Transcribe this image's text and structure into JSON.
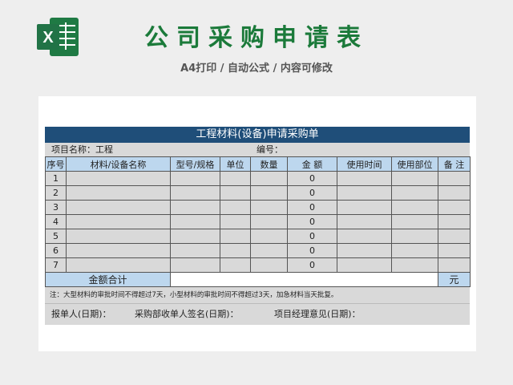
{
  "header": {
    "title": "公司采购申请表",
    "subtitle": "A4打印 / 自动公式 / 内容可修改",
    "logo_icon": "excel-logo-icon",
    "logo_letter": "X",
    "accent_color": "#1b7a3a"
  },
  "form": {
    "title": "工程材料(设备)申请采购单",
    "project_label": "项目名称：工程",
    "number_label": "编号："
  },
  "table": {
    "columns": [
      "序号",
      "材料/设备名称",
      "型号/规格",
      "单位",
      "数量",
      "金 额",
      "使用时间",
      "使用部位",
      "备 注"
    ],
    "rows": [
      [
        "1",
        "",
        "",
        "",
        "",
        "0",
        "",
        "",
        ""
      ],
      [
        "2",
        "",
        "",
        "",
        "",
        "0",
        "",
        "",
        ""
      ],
      [
        "3",
        "",
        "",
        "",
        "",
        "0",
        "",
        "",
        ""
      ],
      [
        "4",
        "",
        "",
        "",
        "",
        "0",
        "",
        "",
        ""
      ],
      [
        "5",
        "",
        "",
        "",
        "",
        "0",
        "",
        "",
        ""
      ],
      [
        "6",
        "",
        "",
        "",
        "",
        "0",
        "",
        "",
        ""
      ],
      [
        "7",
        "",
        "",
        "",
        "",
        "0",
        "",
        "",
        ""
      ]
    ],
    "total_label": "金额合计",
    "total_unit": "元"
  },
  "note": "注：大型材料的审批时间不得超过7天，小型材料的审批时间不得超过3天，加急材料当天批复。",
  "signatures": {
    "reporter": "报单人(日期)：",
    "purchasing": "采购部收单人签名(日期)：",
    "manager": "项目经理意见(日期)："
  }
}
